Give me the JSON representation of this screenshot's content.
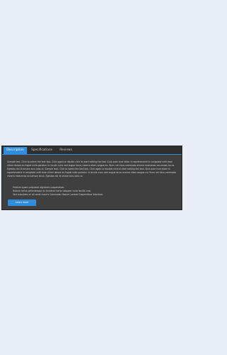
{
  "tabs": [
    {
      "label": "Description",
      "active": true
    },
    {
      "label": "Specifications",
      "active": false
    },
    {
      "label": "Reviews",
      "active": false
    }
  ],
  "description": {
    "text": "Sample text. Click to select the text box. Click again or double click to start editing the text. Duis aute irure dolor in reprehenderit in voluptate velit esse cillum dolore eu fugiat nulla pariatur. In iaculis nunc sed augue lacus viverra vitae congue eu. Nunc vel risus commodo viverra maecenas accumsan lacus. Egestas dui id ornare arcu odio ut. Sample text. Click to select the text box. Click again or double click to start editing the text. Duis aute irure dolor in reprehenderit in voluptate velit esse cillum dolore eu fugiat nulla pariatur. In iaculis nunc sed augue lacus viverra vitae congue eu. Nunc vel risus commodo viverra maecenas accumsan lacus. Egestas dui id ornare arcu odio ut.",
    "features": [
      "Pretium quam vulputate dignissim suspendisse.",
      "Rutrum tellus pellentesque eu tincidunt tortor aliquam nulla facilisi cras.",
      "Sed vulputate mi sit amet mauris Commodo. Neque Laoreet Suspendisse Interdum"
    ],
    "button_label": "Learn more"
  },
  "colors": {
    "page_background": "#e7eef7",
    "widget_background": "#2f2f2f",
    "panel_background": "#3f3f3f",
    "accent": "#2f8ddb",
    "text": "#d2d2d2"
  }
}
